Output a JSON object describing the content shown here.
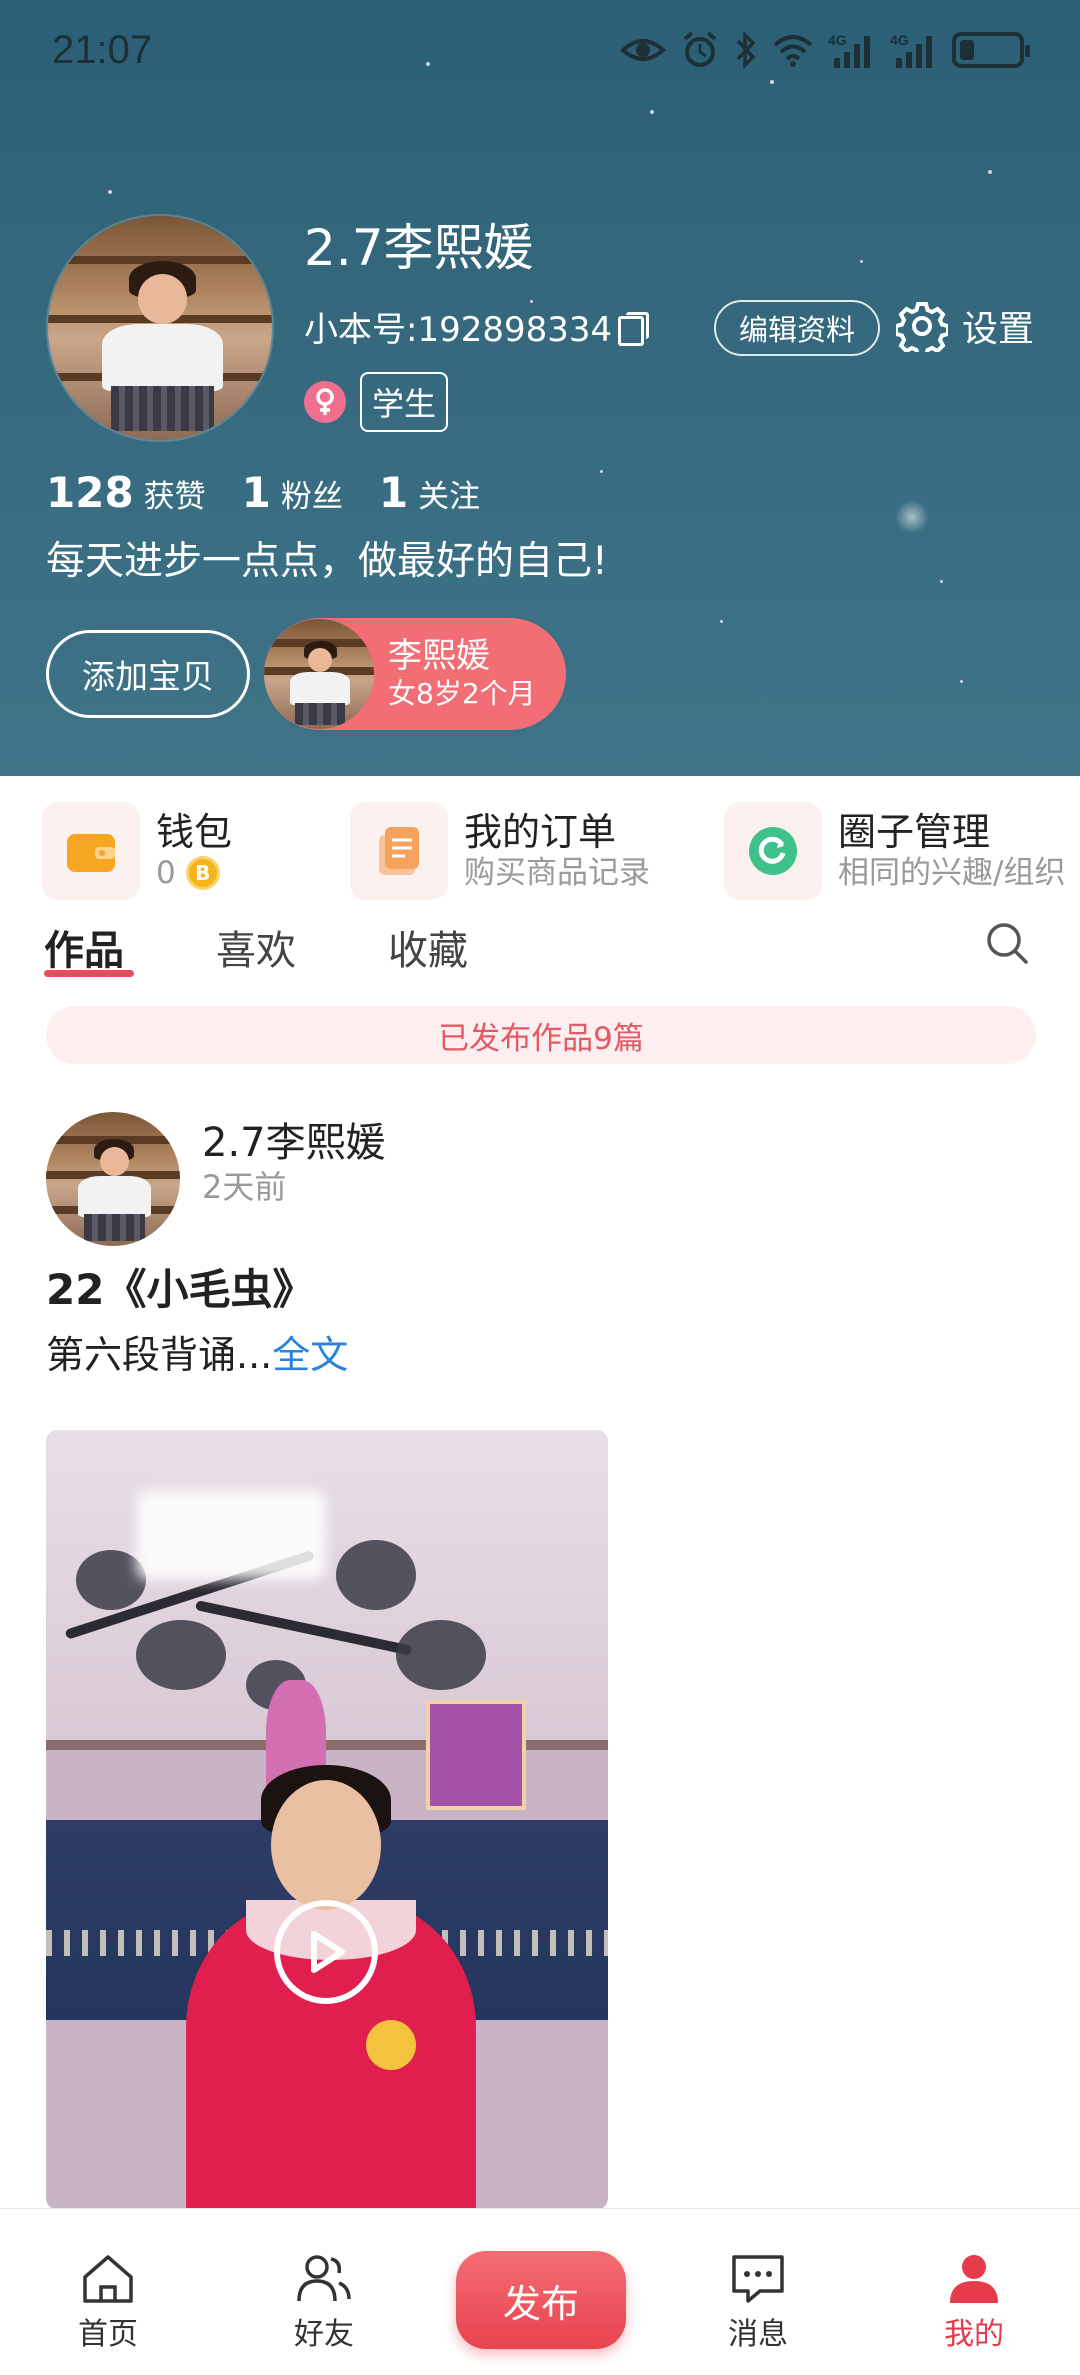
{
  "status_bar": {
    "time": "21:07",
    "network_label_1": "4G",
    "network_label_2": "4G"
  },
  "profile": {
    "name": "2.7李熙媛",
    "uid_label": "小本号:192898334",
    "edit_button": "编辑资料",
    "settings_label": "设置",
    "role_tag": "学生",
    "stats": [
      {
        "value": "128",
        "label": "获赞"
      },
      {
        "value": "1",
        "label": "粉丝"
      },
      {
        "value": "1",
        "label": "关注"
      }
    ],
    "bio": "每天进步一点点，做最好的自己!",
    "add_baby_button": "添加宝贝",
    "baby": {
      "name": "李熙媛",
      "age": "女8岁2个月"
    }
  },
  "quick_entries": [
    {
      "title": "钱包",
      "subtitle": "0",
      "coin_symbol": "B",
      "icon": "wallet-icon",
      "color": "#f5a623"
    },
    {
      "title": "我的订单",
      "subtitle": "购买商品记录",
      "icon": "order-icon",
      "color": "#f5a25d"
    },
    {
      "title": "圈子管理",
      "subtitle": "相同的兴趣/组织",
      "icon": "circle-icon",
      "color": "#3ec18a"
    }
  ],
  "tabs": [
    {
      "label": "作品",
      "active": true
    },
    {
      "label": "喜欢",
      "active": false
    },
    {
      "label": "收藏",
      "active": false
    }
  ],
  "published_banner": "已发布作品9篇",
  "post": {
    "author": "2.7李熙媛",
    "time": "2天前",
    "title": "22《小毛虫》",
    "body": "第六段背诵...",
    "more_link": "全文"
  },
  "bottom_nav": [
    {
      "label": "首页",
      "icon": "home-icon"
    },
    {
      "label": "好友",
      "icon": "friends-icon"
    },
    {
      "label": "发布",
      "icon": "publish-button"
    },
    {
      "label": "消息",
      "icon": "message-icon"
    },
    {
      "label": "我的",
      "icon": "profile-icon",
      "active": true
    }
  ],
  "colors": {
    "accent": "#e63b4b",
    "header_bg": "#35687d",
    "link": "#2a82d9"
  }
}
